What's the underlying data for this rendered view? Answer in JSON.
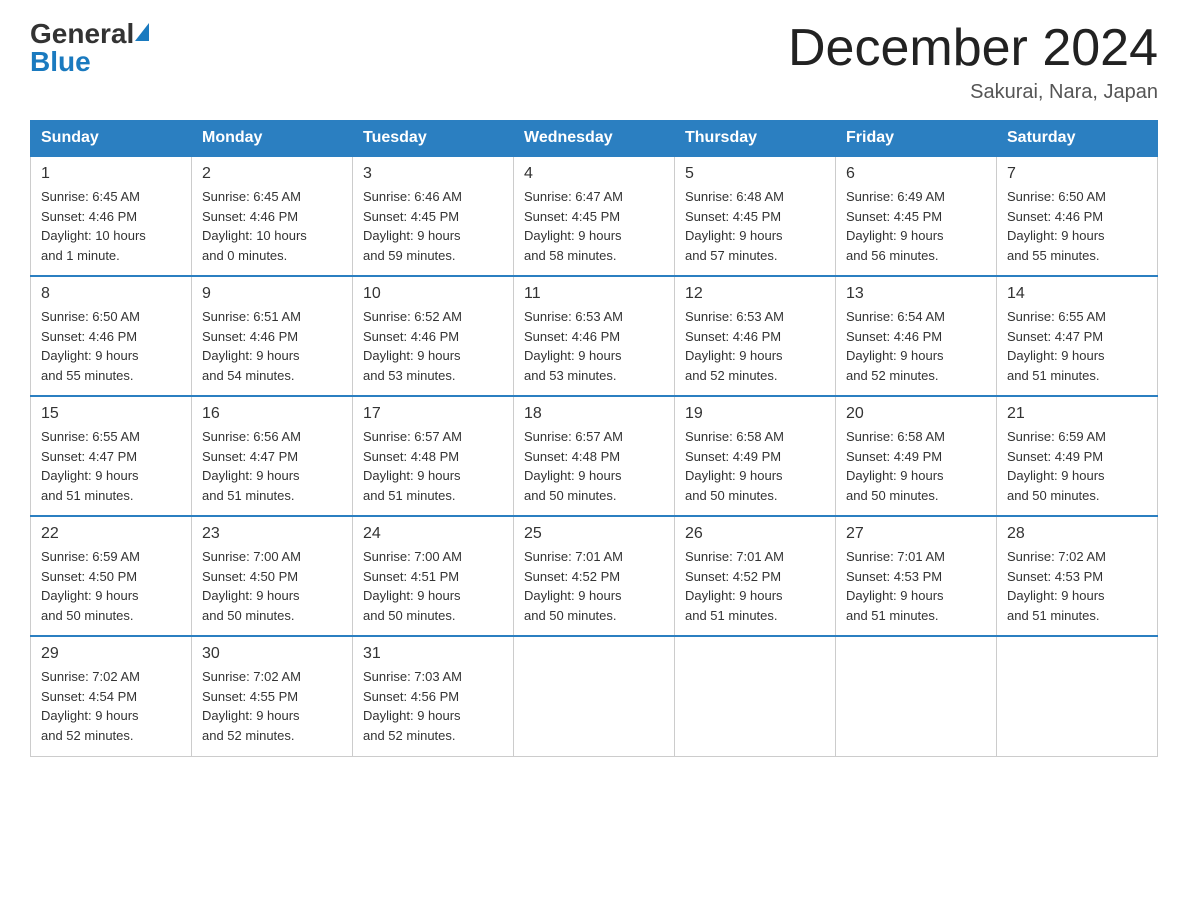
{
  "header": {
    "logo": {
      "general": "General",
      "blue": "Blue"
    },
    "title": "December 2024",
    "location": "Sakurai, Nara, Japan"
  },
  "days_of_week": [
    "Sunday",
    "Monday",
    "Tuesday",
    "Wednesday",
    "Thursday",
    "Friday",
    "Saturday"
  ],
  "weeks": [
    [
      {
        "day": "1",
        "sunrise": "6:45 AM",
        "sunset": "4:46 PM",
        "daylight": "10 hours and 1 minute."
      },
      {
        "day": "2",
        "sunrise": "6:45 AM",
        "sunset": "4:46 PM",
        "daylight": "10 hours and 0 minutes."
      },
      {
        "day": "3",
        "sunrise": "6:46 AM",
        "sunset": "4:45 PM",
        "daylight": "9 hours and 59 minutes."
      },
      {
        "day": "4",
        "sunrise": "6:47 AM",
        "sunset": "4:45 PM",
        "daylight": "9 hours and 58 minutes."
      },
      {
        "day": "5",
        "sunrise": "6:48 AM",
        "sunset": "4:45 PM",
        "daylight": "9 hours and 57 minutes."
      },
      {
        "day": "6",
        "sunrise": "6:49 AM",
        "sunset": "4:45 PM",
        "daylight": "9 hours and 56 minutes."
      },
      {
        "day": "7",
        "sunrise": "6:50 AM",
        "sunset": "4:46 PM",
        "daylight": "9 hours and 55 minutes."
      }
    ],
    [
      {
        "day": "8",
        "sunrise": "6:50 AM",
        "sunset": "4:46 PM",
        "daylight": "9 hours and 55 minutes."
      },
      {
        "day": "9",
        "sunrise": "6:51 AM",
        "sunset": "4:46 PM",
        "daylight": "9 hours and 54 minutes."
      },
      {
        "day": "10",
        "sunrise": "6:52 AM",
        "sunset": "4:46 PM",
        "daylight": "9 hours and 53 minutes."
      },
      {
        "day": "11",
        "sunrise": "6:53 AM",
        "sunset": "4:46 PM",
        "daylight": "9 hours and 53 minutes."
      },
      {
        "day": "12",
        "sunrise": "6:53 AM",
        "sunset": "4:46 PM",
        "daylight": "9 hours and 52 minutes."
      },
      {
        "day": "13",
        "sunrise": "6:54 AM",
        "sunset": "4:46 PM",
        "daylight": "9 hours and 52 minutes."
      },
      {
        "day": "14",
        "sunrise": "6:55 AM",
        "sunset": "4:47 PM",
        "daylight": "9 hours and 51 minutes."
      }
    ],
    [
      {
        "day": "15",
        "sunrise": "6:55 AM",
        "sunset": "4:47 PM",
        "daylight": "9 hours and 51 minutes."
      },
      {
        "day": "16",
        "sunrise": "6:56 AM",
        "sunset": "4:47 PM",
        "daylight": "9 hours and 51 minutes."
      },
      {
        "day": "17",
        "sunrise": "6:57 AM",
        "sunset": "4:48 PM",
        "daylight": "9 hours and 51 minutes."
      },
      {
        "day": "18",
        "sunrise": "6:57 AM",
        "sunset": "4:48 PM",
        "daylight": "9 hours and 50 minutes."
      },
      {
        "day": "19",
        "sunrise": "6:58 AM",
        "sunset": "4:49 PM",
        "daylight": "9 hours and 50 minutes."
      },
      {
        "day": "20",
        "sunrise": "6:58 AM",
        "sunset": "4:49 PM",
        "daylight": "9 hours and 50 minutes."
      },
      {
        "day": "21",
        "sunrise": "6:59 AM",
        "sunset": "4:49 PM",
        "daylight": "9 hours and 50 minutes."
      }
    ],
    [
      {
        "day": "22",
        "sunrise": "6:59 AM",
        "sunset": "4:50 PM",
        "daylight": "9 hours and 50 minutes."
      },
      {
        "day": "23",
        "sunrise": "7:00 AM",
        "sunset": "4:50 PM",
        "daylight": "9 hours and 50 minutes."
      },
      {
        "day": "24",
        "sunrise": "7:00 AM",
        "sunset": "4:51 PM",
        "daylight": "9 hours and 50 minutes."
      },
      {
        "day": "25",
        "sunrise": "7:01 AM",
        "sunset": "4:52 PM",
        "daylight": "9 hours and 50 minutes."
      },
      {
        "day": "26",
        "sunrise": "7:01 AM",
        "sunset": "4:52 PM",
        "daylight": "9 hours and 51 minutes."
      },
      {
        "day": "27",
        "sunrise": "7:01 AM",
        "sunset": "4:53 PM",
        "daylight": "9 hours and 51 minutes."
      },
      {
        "day": "28",
        "sunrise": "7:02 AM",
        "sunset": "4:53 PM",
        "daylight": "9 hours and 51 minutes."
      }
    ],
    [
      {
        "day": "29",
        "sunrise": "7:02 AM",
        "sunset": "4:54 PM",
        "daylight": "9 hours and 52 minutes."
      },
      {
        "day": "30",
        "sunrise": "7:02 AM",
        "sunset": "4:55 PM",
        "daylight": "9 hours and 52 minutes."
      },
      {
        "day": "31",
        "sunrise": "7:03 AM",
        "sunset": "4:56 PM",
        "daylight": "9 hours and 52 minutes."
      },
      {
        "day": "",
        "sunrise": "",
        "sunset": "",
        "daylight": ""
      },
      {
        "day": "",
        "sunrise": "",
        "sunset": "",
        "daylight": ""
      },
      {
        "day": "",
        "sunrise": "",
        "sunset": "",
        "daylight": ""
      },
      {
        "day": "",
        "sunrise": "",
        "sunset": "",
        "daylight": ""
      }
    ]
  ],
  "labels": {
    "sunrise": "Sunrise:",
    "sunset": "Sunset:",
    "daylight": "Daylight:"
  }
}
